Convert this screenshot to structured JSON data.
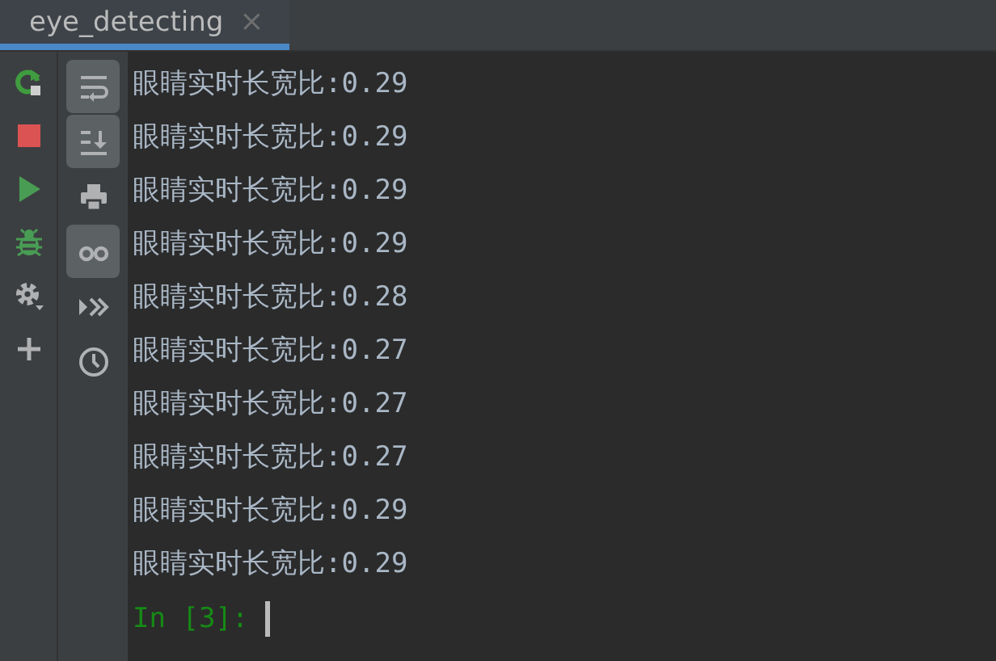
{
  "tabs": [
    {
      "label": "eye_detecting",
      "selected": true,
      "close": "×"
    }
  ],
  "run_toolbar": [
    {
      "kind": "rerun"
    },
    {
      "kind": "stop"
    },
    {
      "kind": "run"
    },
    {
      "kind": "debug"
    },
    {
      "kind": "settings"
    },
    {
      "kind": "add"
    }
  ],
  "console_toolbar": [
    {
      "kind": "wrap",
      "on": true
    },
    {
      "kind": "scroll",
      "on": true
    },
    {
      "kind": "print",
      "on": false
    },
    {
      "kind": "glasses",
      "on": true
    },
    {
      "kind": "forward",
      "on": false
    },
    {
      "kind": "history",
      "on": false
    }
  ],
  "output_lines": [
    "眼睛实时长宽比:0.29",
    "眼睛实时长宽比:0.29",
    "眼睛实时长宽比:0.29",
    "眼睛实时长宽比:0.29",
    "眼睛实时长宽比:0.28",
    "眼睛实时长宽比:0.27",
    "眼睛实时长宽比:0.27",
    "眼睛实时长宽比:0.27",
    "眼睛实时长宽比:0.29",
    "眼睛实时长宽比:0.29"
  ],
  "prompt": "In [3]:"
}
